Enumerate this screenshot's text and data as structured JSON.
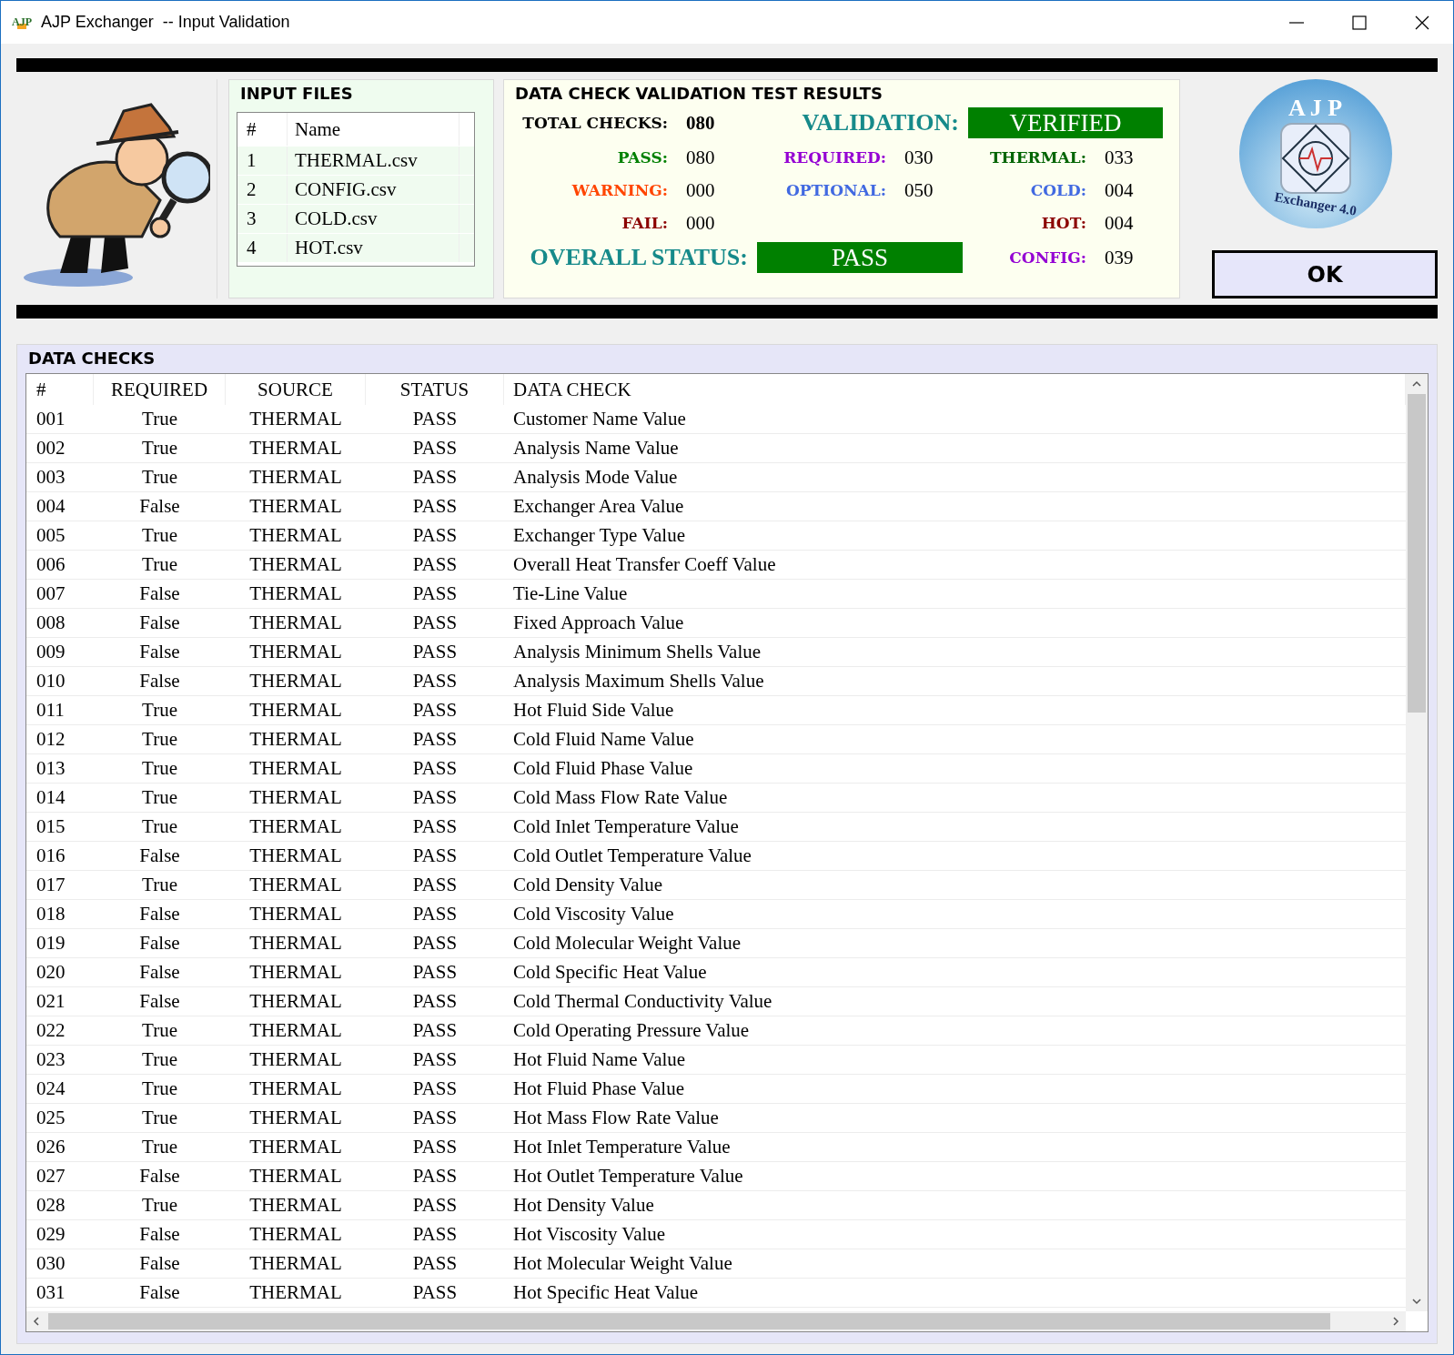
{
  "window": {
    "app_icon": "AJP",
    "title": "AJP Exchanger  -- Input Validation"
  },
  "input_files": {
    "title": "INPUT FILES",
    "columns": [
      "#",
      "Name"
    ],
    "rows": [
      {
        "number": "1",
        "name": "THERMAL.csv"
      },
      {
        "number": "2",
        "name": "CONFIG.csv"
      },
      {
        "number": "3",
        "name": "COLD.csv"
      },
      {
        "number": "4",
        "name": "HOT.csv"
      }
    ]
  },
  "results": {
    "title": "DATA CHECK VALIDATION TEST RESULTS",
    "total": {
      "label": "TOTAL CHECKS:",
      "value": "080"
    },
    "validation": {
      "label": "VALIDATION:",
      "value": "VERIFIED"
    },
    "status_counts": [
      {
        "label": "PASS:",
        "value": "080",
        "color": "#008000"
      },
      {
        "label": "WARNING:",
        "value": "000",
        "color": "#ff4500"
      },
      {
        "label": "FAIL:",
        "value": "000",
        "color": "#8b0000"
      }
    ],
    "requirement_counts": [
      {
        "label": "REQUIRED:",
        "value": "030",
        "color": "#9400d3"
      },
      {
        "label": "OPTIONAL:",
        "value": "050",
        "color": "#4169e1"
      }
    ],
    "source_counts": [
      {
        "label": "THERMAL:",
        "value": "033",
        "color": "#006400"
      },
      {
        "label": "COLD:",
        "value": "004",
        "color": "#4169e1"
      },
      {
        "label": "HOT:",
        "value": "004",
        "color": "#8b0000"
      },
      {
        "label": "CONFIG:",
        "value": "039",
        "color": "#9400d3"
      }
    ],
    "overall": {
      "label": "OVERALL STATUS:",
      "value": "PASS"
    }
  },
  "logo": {
    "title": "A J P",
    "subtitle": "Exchanger 4.0"
  },
  "ok_button": "OK",
  "data_checks": {
    "title": "DATA CHECKS",
    "columns": [
      "#",
      "REQUIRED",
      "SOURCE",
      "STATUS",
      "DATA CHECK"
    ],
    "rows": [
      {
        "number": "001",
        "required": "True",
        "source": "THERMAL",
        "status": "PASS",
        "check": "Customer Name Value"
      },
      {
        "number": "002",
        "required": "True",
        "source": "THERMAL",
        "status": "PASS",
        "check": "Analysis Name Value"
      },
      {
        "number": "003",
        "required": "True",
        "source": "THERMAL",
        "status": "PASS",
        "check": "Analysis Mode Value"
      },
      {
        "number": "004",
        "required": "False",
        "source": "THERMAL",
        "status": "PASS",
        "check": "Exchanger Area Value"
      },
      {
        "number": "005",
        "required": "True",
        "source": "THERMAL",
        "status": "PASS",
        "check": "Exchanger Type Value"
      },
      {
        "number": "006",
        "required": "True",
        "source": "THERMAL",
        "status": "PASS",
        "check": "Overall Heat Transfer Coeff Value"
      },
      {
        "number": "007",
        "required": "False",
        "source": "THERMAL",
        "status": "PASS",
        "check": "Tie-Line Value"
      },
      {
        "number": "008",
        "required": "False",
        "source": "THERMAL",
        "status": "PASS",
        "check": "Fixed Approach Value"
      },
      {
        "number": "009",
        "required": "False",
        "source": "THERMAL",
        "status": "PASS",
        "check": "Analysis Minimum Shells Value"
      },
      {
        "number": "010",
        "required": "False",
        "source": "THERMAL",
        "status": "PASS",
        "check": "Analysis Maximum Shells Value"
      },
      {
        "number": "011",
        "required": "True",
        "source": "THERMAL",
        "status": "PASS",
        "check": "Hot Fluid Side Value"
      },
      {
        "number": "012",
        "required": "True",
        "source": "THERMAL",
        "status": "PASS",
        "check": "Cold Fluid Name Value"
      },
      {
        "number": "013",
        "required": "True",
        "source": "THERMAL",
        "status": "PASS",
        "check": "Cold Fluid Phase Value"
      },
      {
        "number": "014",
        "required": "True",
        "source": "THERMAL",
        "status": "PASS",
        "check": "Cold Mass Flow Rate Value"
      },
      {
        "number": "015",
        "required": "True",
        "source": "THERMAL",
        "status": "PASS",
        "check": "Cold Inlet Temperature Value"
      },
      {
        "number": "016",
        "required": "False",
        "source": "THERMAL",
        "status": "PASS",
        "check": "Cold Outlet Temperature Value"
      },
      {
        "number": "017",
        "required": "True",
        "source": "THERMAL",
        "status": "PASS",
        "check": "Cold Density Value"
      },
      {
        "number": "018",
        "required": "False",
        "source": "THERMAL",
        "status": "PASS",
        "check": "Cold Viscosity Value"
      },
      {
        "number": "019",
        "required": "False",
        "source": "THERMAL",
        "status": "PASS",
        "check": "Cold Molecular Weight Value"
      },
      {
        "number": "020",
        "required": "False",
        "source": "THERMAL",
        "status": "PASS",
        "check": "Cold Specific Heat Value"
      },
      {
        "number": "021",
        "required": "False",
        "source": "THERMAL",
        "status": "PASS",
        "check": "Cold Thermal Conductivity Value"
      },
      {
        "number": "022",
        "required": "True",
        "source": "THERMAL",
        "status": "PASS",
        "check": "Cold Operating Pressure Value"
      },
      {
        "number": "023",
        "required": "True",
        "source": "THERMAL",
        "status": "PASS",
        "check": "Hot Fluid Name Value"
      },
      {
        "number": "024",
        "required": "True",
        "source": "THERMAL",
        "status": "PASS",
        "check": "Hot Fluid Phase Value"
      },
      {
        "number": "025",
        "required": "True",
        "source": "THERMAL",
        "status": "PASS",
        "check": "Hot Mass Flow Rate Value"
      },
      {
        "number": "026",
        "required": "True",
        "source": "THERMAL",
        "status": "PASS",
        "check": "Hot Inlet Temperature Value"
      },
      {
        "number": "027",
        "required": "False",
        "source": "THERMAL",
        "status": "PASS",
        "check": "Hot Outlet Temperature Value"
      },
      {
        "number": "028",
        "required": "True",
        "source": "THERMAL",
        "status": "PASS",
        "check": "Hot Density Value"
      },
      {
        "number": "029",
        "required": "False",
        "source": "THERMAL",
        "status": "PASS",
        "check": "Hot Viscosity Value"
      },
      {
        "number": "030",
        "required": "False",
        "source": "THERMAL",
        "status": "PASS",
        "check": "Hot Molecular Weight Value"
      },
      {
        "number": "031",
        "required": "False",
        "source": "THERMAL",
        "status": "PASS",
        "check": "Hot Specific Heat Value"
      }
    ]
  }
}
